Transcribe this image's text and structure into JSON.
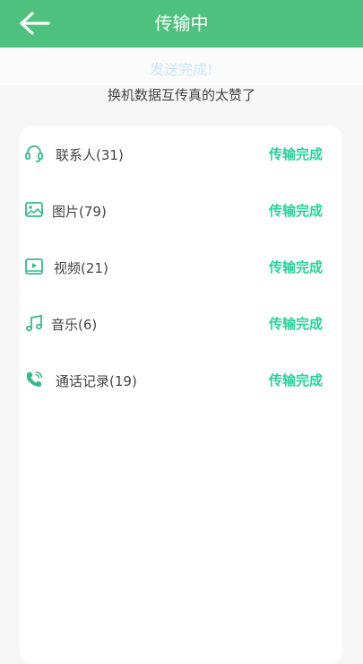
{
  "header": {
    "title": "传输中",
    "back_icon": "arrow-left-icon"
  },
  "banner": {
    "status_text": "发送完成!",
    "subtitle": "换机数据互传真的太赞了"
  },
  "colors": {
    "header_bg": "#4fc17f",
    "accent": "#2ecf9a",
    "icon": "#38b98a"
  },
  "items": [
    {
      "icon": "headset-icon",
      "label": "联系人(31)",
      "status": "传输完成"
    },
    {
      "icon": "image-icon",
      "label": "图片(79)",
      "status": "传输完成"
    },
    {
      "icon": "video-icon",
      "label": "视频(21)",
      "status": "传输完成"
    },
    {
      "icon": "music-note-icon",
      "label": "音乐(6)",
      "status": "传输完成"
    },
    {
      "icon": "phone-call-icon",
      "label": "通话记录(19)",
      "status": "传输完成"
    }
  ]
}
